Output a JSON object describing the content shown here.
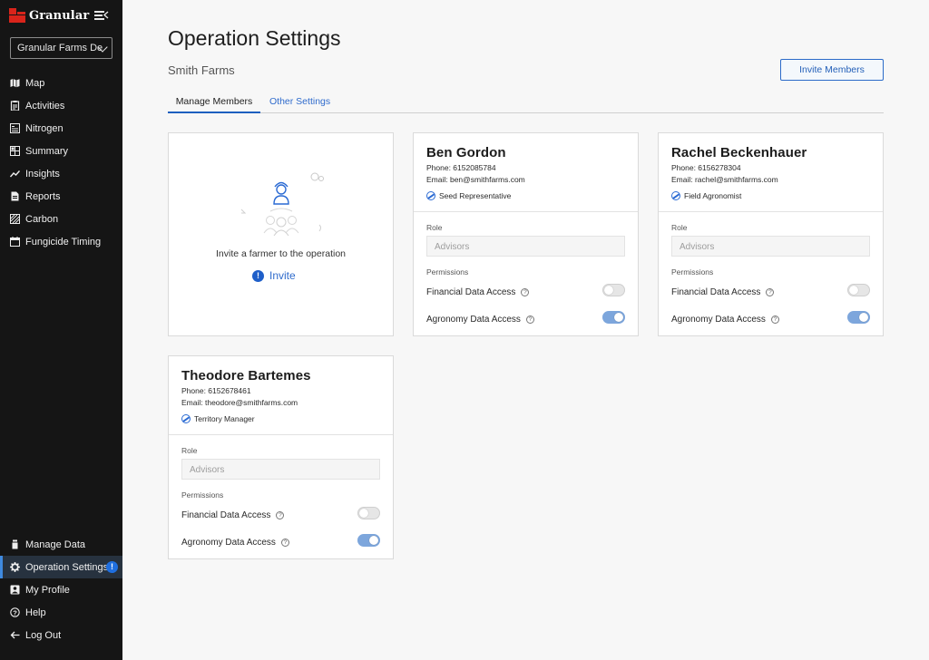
{
  "app": {
    "brand": "Granular",
    "farm_selector": "Granular Farms De"
  },
  "sidebar": {
    "top_items": [
      {
        "label": "Map",
        "icon": "map-icon"
      },
      {
        "label": "Activities",
        "icon": "clipboard-icon"
      },
      {
        "label": "Nitrogen",
        "icon": "nitrogen-icon"
      },
      {
        "label": "Summary",
        "icon": "summary-icon"
      },
      {
        "label": "Insights",
        "icon": "insights-icon"
      },
      {
        "label": "Reports",
        "icon": "reports-icon"
      },
      {
        "label": "Carbon",
        "icon": "carbon-icon"
      },
      {
        "label": "Fungicide Timing",
        "icon": "calendar-icon"
      }
    ],
    "bottom_items": [
      {
        "label": "Manage Data",
        "icon": "data-icon"
      },
      {
        "label": "Operation Settings",
        "icon": "gear-icon",
        "badge": "!"
      },
      {
        "label": "My Profile",
        "icon": "profile-icon"
      },
      {
        "label": "Help",
        "icon": "help-icon"
      },
      {
        "label": "Log Out",
        "icon": "logout-icon"
      }
    ]
  },
  "page": {
    "title": "Operation Settings",
    "subtitle": "Smith Farms",
    "invite_members_label": "Invite Members",
    "tabs": [
      {
        "label": "Manage Members",
        "active": true
      },
      {
        "label": "Other Settings",
        "active": false
      }
    ]
  },
  "invite_card": {
    "text": "Invite a farmer to the operation",
    "link_label": "Invite",
    "badge": "!"
  },
  "members": [
    {
      "name": "Ben Gordon",
      "phone": "Phone: 6152085784",
      "email": "Email: ben@smithfarms.com",
      "role_tag": "Seed Representative",
      "role_label": "Role",
      "role_value": "Advisors",
      "permissions_label": "Permissions",
      "financial_label": "Financial Data Access",
      "financial_on": false,
      "agronomy_label": "Agronomy Data Access",
      "agronomy_on": true
    },
    {
      "name": "Rachel Beckenhauer",
      "phone": "Phone: 6156278304",
      "email": "Email: rachel@smithfarms.com",
      "role_tag": "Field Agronomist",
      "role_label": "Role",
      "role_value": "Advisors",
      "permissions_label": "Permissions",
      "financial_label": "Financial Data Access",
      "financial_on": false,
      "agronomy_label": "Agronomy Data Access",
      "agronomy_on": true
    },
    {
      "name": "Theodore Bartemes",
      "phone": "Phone: 6152678461",
      "email": "Email: theodore@smithfarms.com",
      "role_tag": "Territory Manager",
      "role_label": "Role",
      "role_value": "Advisors",
      "permissions_label": "Permissions",
      "financial_label": "Financial Data Access",
      "financial_on": false,
      "agronomy_label": "Agronomy Data Access",
      "agronomy_on": true
    }
  ],
  "qmark_glyph": "?",
  "colors": {
    "sidebar_bg": "#151515",
    "accent": "#2c6bc9",
    "brand_red": "#d9241b",
    "toggle_on": "#7da6dc"
  }
}
